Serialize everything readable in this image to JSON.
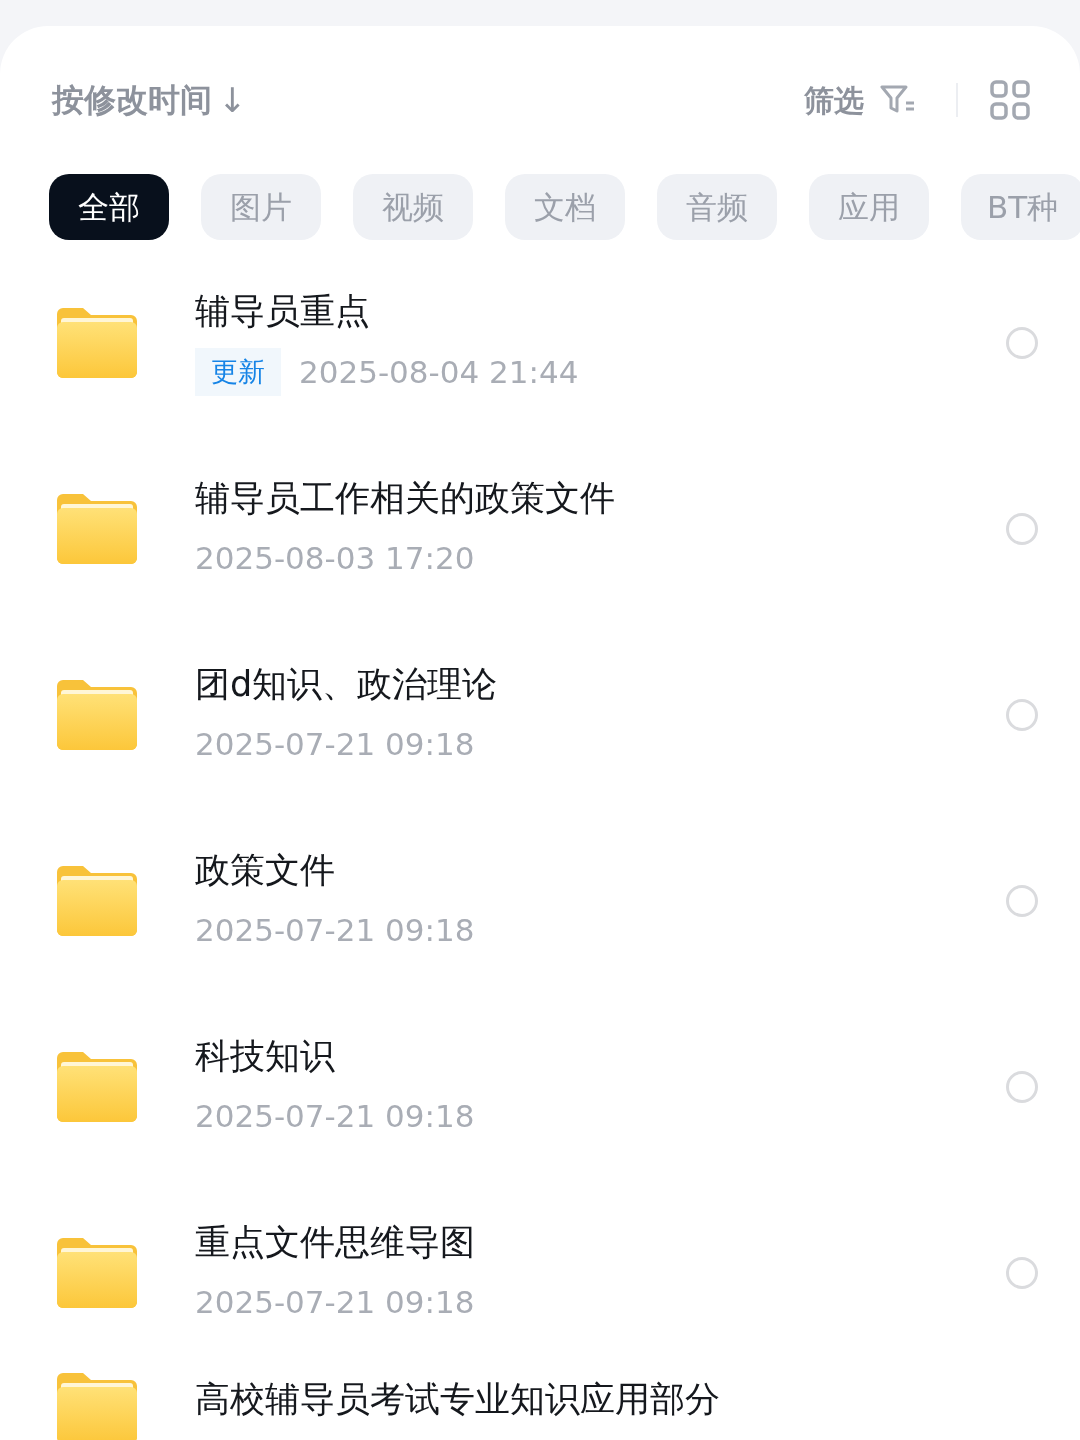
{
  "toolbar": {
    "sort_label": "按修改时间",
    "sort_arrow": "↓",
    "filter_label": "筛选"
  },
  "categories": [
    {
      "label": "全部",
      "selected": true
    },
    {
      "label": "图片",
      "selected": false
    },
    {
      "label": "视频",
      "selected": false
    },
    {
      "label": "文档",
      "selected": false
    },
    {
      "label": "音频",
      "selected": false
    },
    {
      "label": "应用",
      "selected": false
    },
    {
      "label": "BT种",
      "selected": false
    }
  ],
  "files": [
    {
      "name": "辅导员重点",
      "badge": "更新",
      "date": "2025-08-04",
      "time": "21:44",
      "checked": false
    },
    {
      "name": "辅导员工作相关的政策文件",
      "date": "2025-08-03",
      "time": "17:20",
      "checked": false
    },
    {
      "name": "团d知识、政治理论",
      "date": "2025-07-21",
      "time": "09:18",
      "checked": false
    },
    {
      "name": "政策文件",
      "date": "2025-07-21",
      "time": "09:18",
      "checked": false
    },
    {
      "name": "科技知识",
      "date": "2025-07-21",
      "time": "09:18",
      "checked": false
    },
    {
      "name": "重点文件思维导图",
      "date": "2025-07-21",
      "time": "09:18",
      "checked": false
    },
    {
      "name": "高校辅导员考试专业知识应用部分"
    }
  ]
}
